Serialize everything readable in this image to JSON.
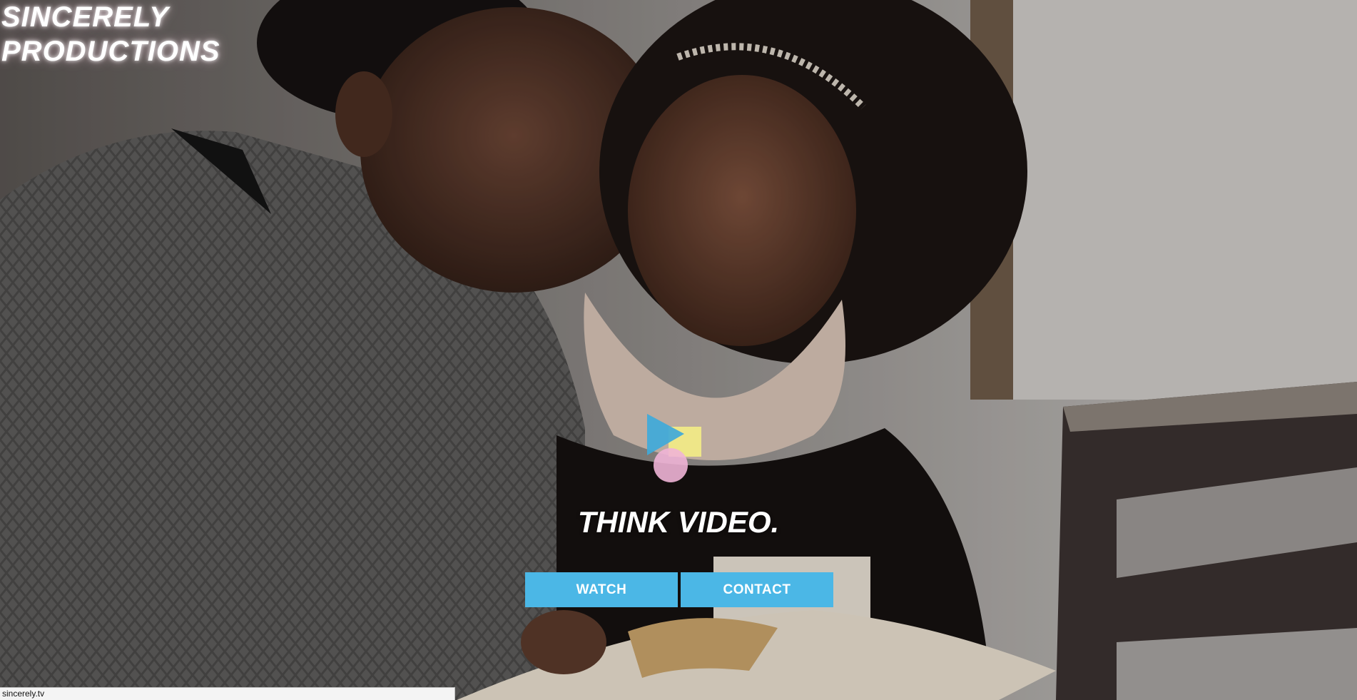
{
  "brand": {
    "line1": "SINCERELY",
    "line2": "PRODUCTIONS"
  },
  "hero": {
    "tagline": "THINK VIDEO.",
    "background_image": "woman-and-girl-reading-book-photo"
  },
  "buttons": {
    "watch_label": "WATCH",
    "contact_label": "CONTACT"
  },
  "status_bar": {
    "url": "sincerely.tv"
  },
  "colors": {
    "accent_blue": "#4bb7e6",
    "logo_blue": "#3fa9d9",
    "logo_yellow": "#f2ea86",
    "logo_pink": "#f0b4d6"
  },
  "icons": {
    "logo": "play-square-circle-logo-icon"
  }
}
